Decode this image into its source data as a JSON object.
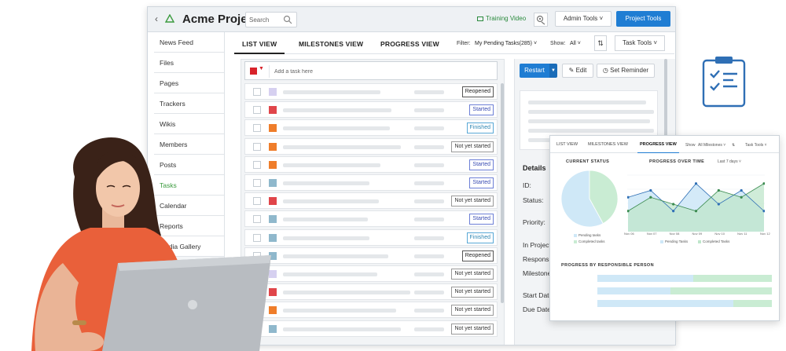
{
  "app": {
    "project_title": "Acme Project",
    "search_placeholder": "Search",
    "training_video": "Training Video",
    "admin_tools": "Admin Tools",
    "project_tools": "Project Tools"
  },
  "sidebar": {
    "items": [
      {
        "label": "News Feed"
      },
      {
        "label": "Files"
      },
      {
        "label": "Pages"
      },
      {
        "label": "Trackers"
      },
      {
        "label": "Wikis"
      },
      {
        "label": "Members"
      },
      {
        "label": "Posts"
      },
      {
        "label": "Tasks",
        "active": true
      },
      {
        "label": "Calendar"
      },
      {
        "label": "Reports"
      },
      {
        "label": "Media Gallery"
      }
    ]
  },
  "views": {
    "tabs": [
      "LIST VIEW",
      "MILESTONES VIEW",
      "PROGRESS VIEW"
    ],
    "active": "LIST VIEW",
    "filter_label": "Filter:",
    "filter_value": "My Pending Tasks(285)",
    "show_label": "Show:",
    "show_value": "All",
    "task_tools": "Task Tools"
  },
  "tasklist": {
    "add_placeholder": "Add a task here",
    "rows": [
      {
        "priority_color": "#d6d0f0",
        "status": "Reopened",
        "kind": "reopened"
      },
      {
        "priority_color": "#e0454a",
        "status": "Started",
        "kind": "started"
      },
      {
        "priority_color": "#ef7d2a",
        "status": "Finished",
        "kind": "finished"
      },
      {
        "priority_color": "#ef7d2a",
        "status": "Not yet started",
        "kind": "not"
      },
      {
        "priority_color": "#ef7d2a",
        "status": "Started",
        "kind": "started"
      },
      {
        "priority_color": "#8fb8cc",
        "status": "Started",
        "kind": "started"
      },
      {
        "priority_color": "#e0454a",
        "status": "Not yet started",
        "kind": "not"
      },
      {
        "priority_color": "#8fb8cc",
        "status": "Started",
        "kind": "started"
      },
      {
        "priority_color": "#8fb8cc",
        "status": "Finished",
        "kind": "finished"
      },
      {
        "priority_color": "#8fb8cc",
        "status": "Reopened",
        "kind": "reopened"
      },
      {
        "priority_color": "#d6d0f0",
        "status": "Not yet started",
        "kind": "not"
      },
      {
        "priority_color": "#e0454a",
        "status": "Not yet started",
        "kind": "not"
      },
      {
        "priority_color": "#ef7d2a",
        "status": "Not yet started",
        "kind": "not"
      },
      {
        "priority_color": "#8fb8cc",
        "status": "Not yet started",
        "kind": "not"
      }
    ]
  },
  "detail": {
    "restart": "Restart",
    "edit": "Edit",
    "set_reminder": "Set Reminder",
    "details_heading": "Details",
    "fields": [
      "ID:",
      "Status:",
      "Priority:",
      "In Projects",
      "Responsibl",
      "Milestone",
      "Start Date",
      "Due Date:"
    ]
  },
  "progress_view": {
    "tabs": [
      "LIST VIEW",
      "MILESTONES VIEW",
      "PROGRESS VIEW"
    ],
    "active": "PROGRESS VIEW",
    "show_label": "Show",
    "show_value": "All Milestones",
    "task_tools": "Task Tools",
    "current_status_title": "CURRENT STATUS",
    "progress_over_time_title": "PROGRESS OVER TIME",
    "range_value": "Last 7 days",
    "legend_pending": "Pending tasks",
    "legend_completed": "Completed tasks",
    "legend_pending_line": "Pending Tasks",
    "legend_completed_line": "Completed Tasks",
    "by_person_title": "PROGRESS BY RESPONSIBLE PERSON"
  },
  "chart_data": [
    {
      "type": "pie",
      "title": "CURRENT STATUS",
      "categories": [
        "Pending tasks",
        "Completed tasks"
      ],
      "values": [
        58,
        42
      ],
      "colors": [
        "#cfe8f7",
        "#c9ecd3"
      ]
    },
    {
      "type": "area",
      "title": "PROGRESS OVER TIME",
      "categories": [
        "Nov 06",
        "Nov 07",
        "Nov 08",
        "Nov 09",
        "Nov 10",
        "Nov 11",
        "Nov 12"
      ],
      "series": [
        {
          "name": "Pending Tasks",
          "values": [
            5,
            6,
            3,
            7,
            4,
            6,
            3
          ],
          "color": "#cfe8f7"
        },
        {
          "name": "Completed Tasks",
          "values": [
            3,
            5,
            4,
            3,
            6,
            5,
            7
          ],
          "color": "#bfe6cb"
        }
      ],
      "legend": "bottom"
    },
    {
      "type": "bar",
      "title": "PROGRESS BY RESPONSIBLE PERSON",
      "categories": [
        "",
        "",
        ""
      ],
      "series": [
        {
          "name": "Pending Tasks",
          "values": [
            55,
            42,
            78
          ],
          "color": "#cfe8f7"
        },
        {
          "name": "Completed Tasks",
          "values": [
            45,
            58,
            22
          ],
          "color": "#c9ecd3"
        }
      ],
      "orientation": "horizontal",
      "stacked": true
    }
  ]
}
